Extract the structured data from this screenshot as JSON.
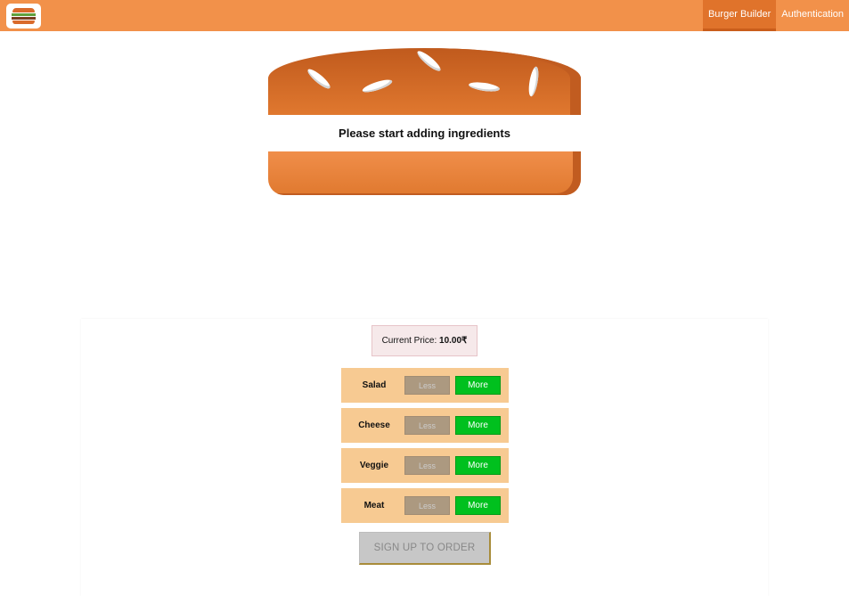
{
  "toolbar": {
    "logo_icon": "burger-logo-icon",
    "nav": [
      {
        "label": "Burger Builder",
        "active": true
      },
      {
        "label": "Authentication",
        "active": false
      }
    ]
  },
  "burger": {
    "empty_message": "Please start adding ingredients"
  },
  "price": {
    "label": "Current Price:",
    "value": "10.00₹"
  },
  "controls": [
    {
      "label": "Salad",
      "less": "Less",
      "more": "More"
    },
    {
      "label": "Cheese",
      "less": "Less",
      "more": "More"
    },
    {
      "label": "Veggie",
      "less": "Less",
      "more": "More"
    },
    {
      "label": "Meat",
      "less": "Less",
      "more": "More"
    }
  ],
  "order_button": "SIGN UP TO ORDER",
  "colors": {
    "toolbar": "#f2914a",
    "active_nav": "#e0732b",
    "bread": "#e0782f",
    "control_row": "#f7ca92",
    "more_button": "#00c01e",
    "less_button": "#ac9980"
  }
}
